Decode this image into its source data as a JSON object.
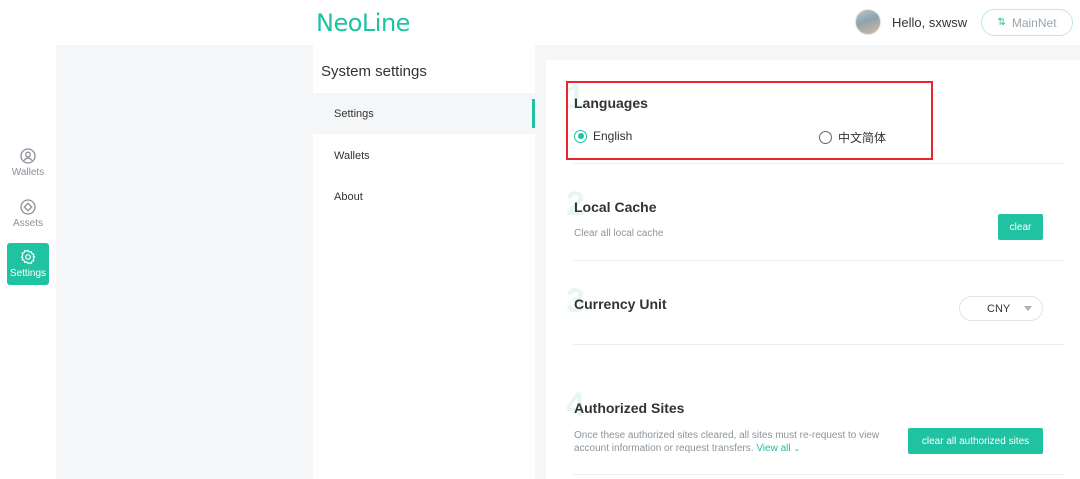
{
  "header": {
    "logo": "NeoLine",
    "greeting": "Hello, sxwsw",
    "network_label": "MainNet",
    "network_icon": "⇅"
  },
  "rail": {
    "items": [
      {
        "label": "Wallets",
        "icon": "wallet-icon"
      },
      {
        "label": "Assets",
        "icon": "assets-icon"
      },
      {
        "label": "Settings",
        "icon": "gear-icon"
      }
    ],
    "active": "Settings"
  },
  "menu": {
    "title": "System settings",
    "items": [
      {
        "label": "Settings"
      },
      {
        "label": "Wallets"
      },
      {
        "label": "About"
      }
    ],
    "active": "Settings"
  },
  "sections": {
    "languages": {
      "num": "1",
      "title": "Languages",
      "options": [
        "English",
        "中文简体"
      ],
      "selected": "English"
    },
    "local_cache": {
      "num": "2",
      "title": "Local Cache",
      "desc": "Clear all local cache",
      "button": "clear"
    },
    "currency": {
      "num": "3",
      "title": "Currency Unit",
      "selected": "CNY"
    },
    "authorized": {
      "num": "4",
      "title": "Authorized Sites",
      "desc_line1": "Once these authorized sites cleared, all sites must re-request to view",
      "desc_line2": "account information or request transfers.",
      "view_all": "View all",
      "button": "clear all authorized sites"
    }
  },
  "colors": {
    "accent": "#1fc2a1",
    "highlight_border": "#e8262b"
  }
}
